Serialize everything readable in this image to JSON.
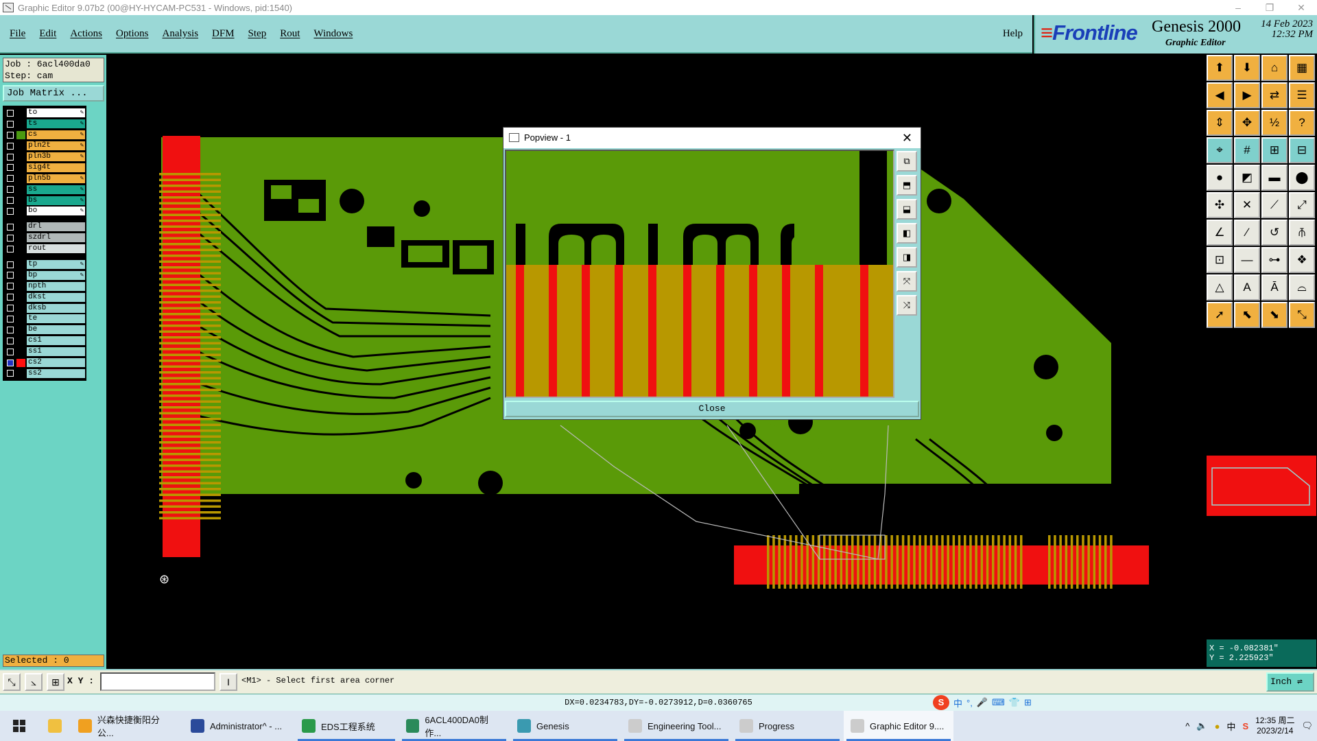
{
  "window": {
    "title": "Graphic Editor 9.07b2 (00@HY-HYCAM-PC531 - Windows, pid:1540)",
    "min": "–",
    "max": "❐",
    "close": "✕"
  },
  "menu": {
    "items": [
      "File",
      "Edit",
      "Actions",
      "Options",
      "Analysis",
      "DFM",
      "Step",
      "Rout",
      "Windows"
    ],
    "help": "Help"
  },
  "brand": {
    "logo": "Frontline",
    "product": "Genesis 2000",
    "subtitle": "Graphic Editor",
    "date": "14 Feb 2023",
    "time": "12:32 PM"
  },
  "job": {
    "job_line": "Job : 6acl400da0",
    "step_line": "Step: cam",
    "matrix_button": "Job Matrix ..."
  },
  "layers": [
    {
      "name": "to",
      "bg": "#ffffff",
      "sw": "#000000",
      "pen": true,
      "group": 1
    },
    {
      "name": "ts",
      "bg": "#1aa88e",
      "sw": "#000000",
      "pen": true,
      "group": 1
    },
    {
      "name": "cs",
      "bg": "#f0b040",
      "sw": "#4a9a10",
      "pen": true,
      "group": 1
    },
    {
      "name": "pln2t",
      "bg": "#f0b040",
      "sw": "#000000",
      "pen": true,
      "group": 1
    },
    {
      "name": "pln3b",
      "bg": "#f0b040",
      "sw": "#000000",
      "pen": true,
      "group": 1
    },
    {
      "name": "sig4t",
      "bg": "#f0b040",
      "sw": "#000000",
      "pen": false,
      "group": 1
    },
    {
      "name": "pln5b",
      "bg": "#f0b040",
      "sw": "#000000",
      "pen": true,
      "group": 1
    },
    {
      "name": "ss",
      "bg": "#1aa88e",
      "sw": "#000000",
      "pen": true,
      "group": 1
    },
    {
      "name": "bs",
      "bg": "#1aa88e",
      "sw": "#000000",
      "pen": true,
      "group": 1
    },
    {
      "name": "bo",
      "bg": "#ffffff",
      "sw": "#000000",
      "pen": true,
      "group": 1
    },
    {
      "name": "drl",
      "bg": "#b0b8b8",
      "sw": "#000000",
      "pen": false,
      "group": 2
    },
    {
      "name": "szdrl",
      "bg": "#b0b8b8",
      "sw": "#000000",
      "pen": false,
      "group": 2
    },
    {
      "name": "rout",
      "bg": "#d8e0e0",
      "sw": "#000000",
      "pen": false,
      "group": 2
    },
    {
      "name": "tp",
      "bg": "#9ad8d6",
      "sw": "#000000",
      "pen": true,
      "group": 3
    },
    {
      "name": "bp",
      "bg": "#9ad8d6",
      "sw": "#000000",
      "pen": true,
      "group": 3
    },
    {
      "name": "npth",
      "bg": "#9ad8d6",
      "sw": "#000000",
      "pen": false,
      "group": 3
    },
    {
      "name": "dkst",
      "bg": "#9ad8d6",
      "sw": "#000000",
      "pen": false,
      "group": 3
    },
    {
      "name": "dksb",
      "bg": "#9ad8d6",
      "sw": "#000000",
      "pen": false,
      "group": 3
    },
    {
      "name": "te",
      "bg": "#9ad8d6",
      "sw": "#000000",
      "pen": false,
      "group": 3
    },
    {
      "name": "be",
      "bg": "#9ad8d6",
      "sw": "#000000",
      "pen": false,
      "group": 3
    },
    {
      "name": "cs1",
      "bg": "#9ad8d6",
      "sw": "#000000",
      "pen": false,
      "group": 3
    },
    {
      "name": "ss1",
      "bg": "#9ad8d6",
      "sw": "#000000",
      "pen": false,
      "group": 3
    },
    {
      "name": "cs2",
      "bg": "#9ad8d6",
      "sw": "#ff1010",
      "pen": false,
      "group": 3,
      "active": true
    },
    {
      "name": "ss2",
      "bg": "#9ad8d6",
      "sw": "#000000",
      "pen": false,
      "group": 3
    }
  ],
  "selected": "Selected : 0",
  "popup": {
    "title": "Popview - 1",
    "close_label": "Close"
  },
  "coords": {
    "x": "X = -0.082381\"",
    "y": "Y = 2.225923\""
  },
  "bottom": {
    "xy_label": "X Y :",
    "xy_value": "",
    "prompt": "<M1> - Select first area corner",
    "unit": "Inch ⇌"
  },
  "status": "DX=0.0234783,DY=-0.0273912,D=0.0360765",
  "ime": [
    "中",
    "°,",
    "🎤",
    "⌨",
    "👕",
    "⊞"
  ],
  "taskbar": {
    "items": [
      {
        "label": "兴森快捷衡阳分公...",
        "color": "#f0a020"
      },
      {
        "label": "Administrator^ - ...",
        "color": "#2a4a9a"
      },
      {
        "label": "EDS工程系统",
        "color": "#2a9a4a"
      },
      {
        "label": "6ACL400DA0制作...",
        "color": "#2a8a5a"
      },
      {
        "label": "Genesis",
        "color": "#3a9ab0"
      },
      {
        "label": "Engineering Tool...",
        "color": "#cccccc"
      },
      {
        "label": "Progress",
        "color": "#cccccc"
      },
      {
        "label": "Graphic Editor 9....",
        "color": "#cccccc",
        "active": true
      }
    ],
    "tray_lang": "中",
    "clock_time": "12:35 周二",
    "clock_date": "2023/2/14"
  },
  "colors": {
    "copper": "#5a9a08",
    "pad": "#f01010",
    "overlap": "#b89800",
    "panel": "#9ad8d6"
  }
}
